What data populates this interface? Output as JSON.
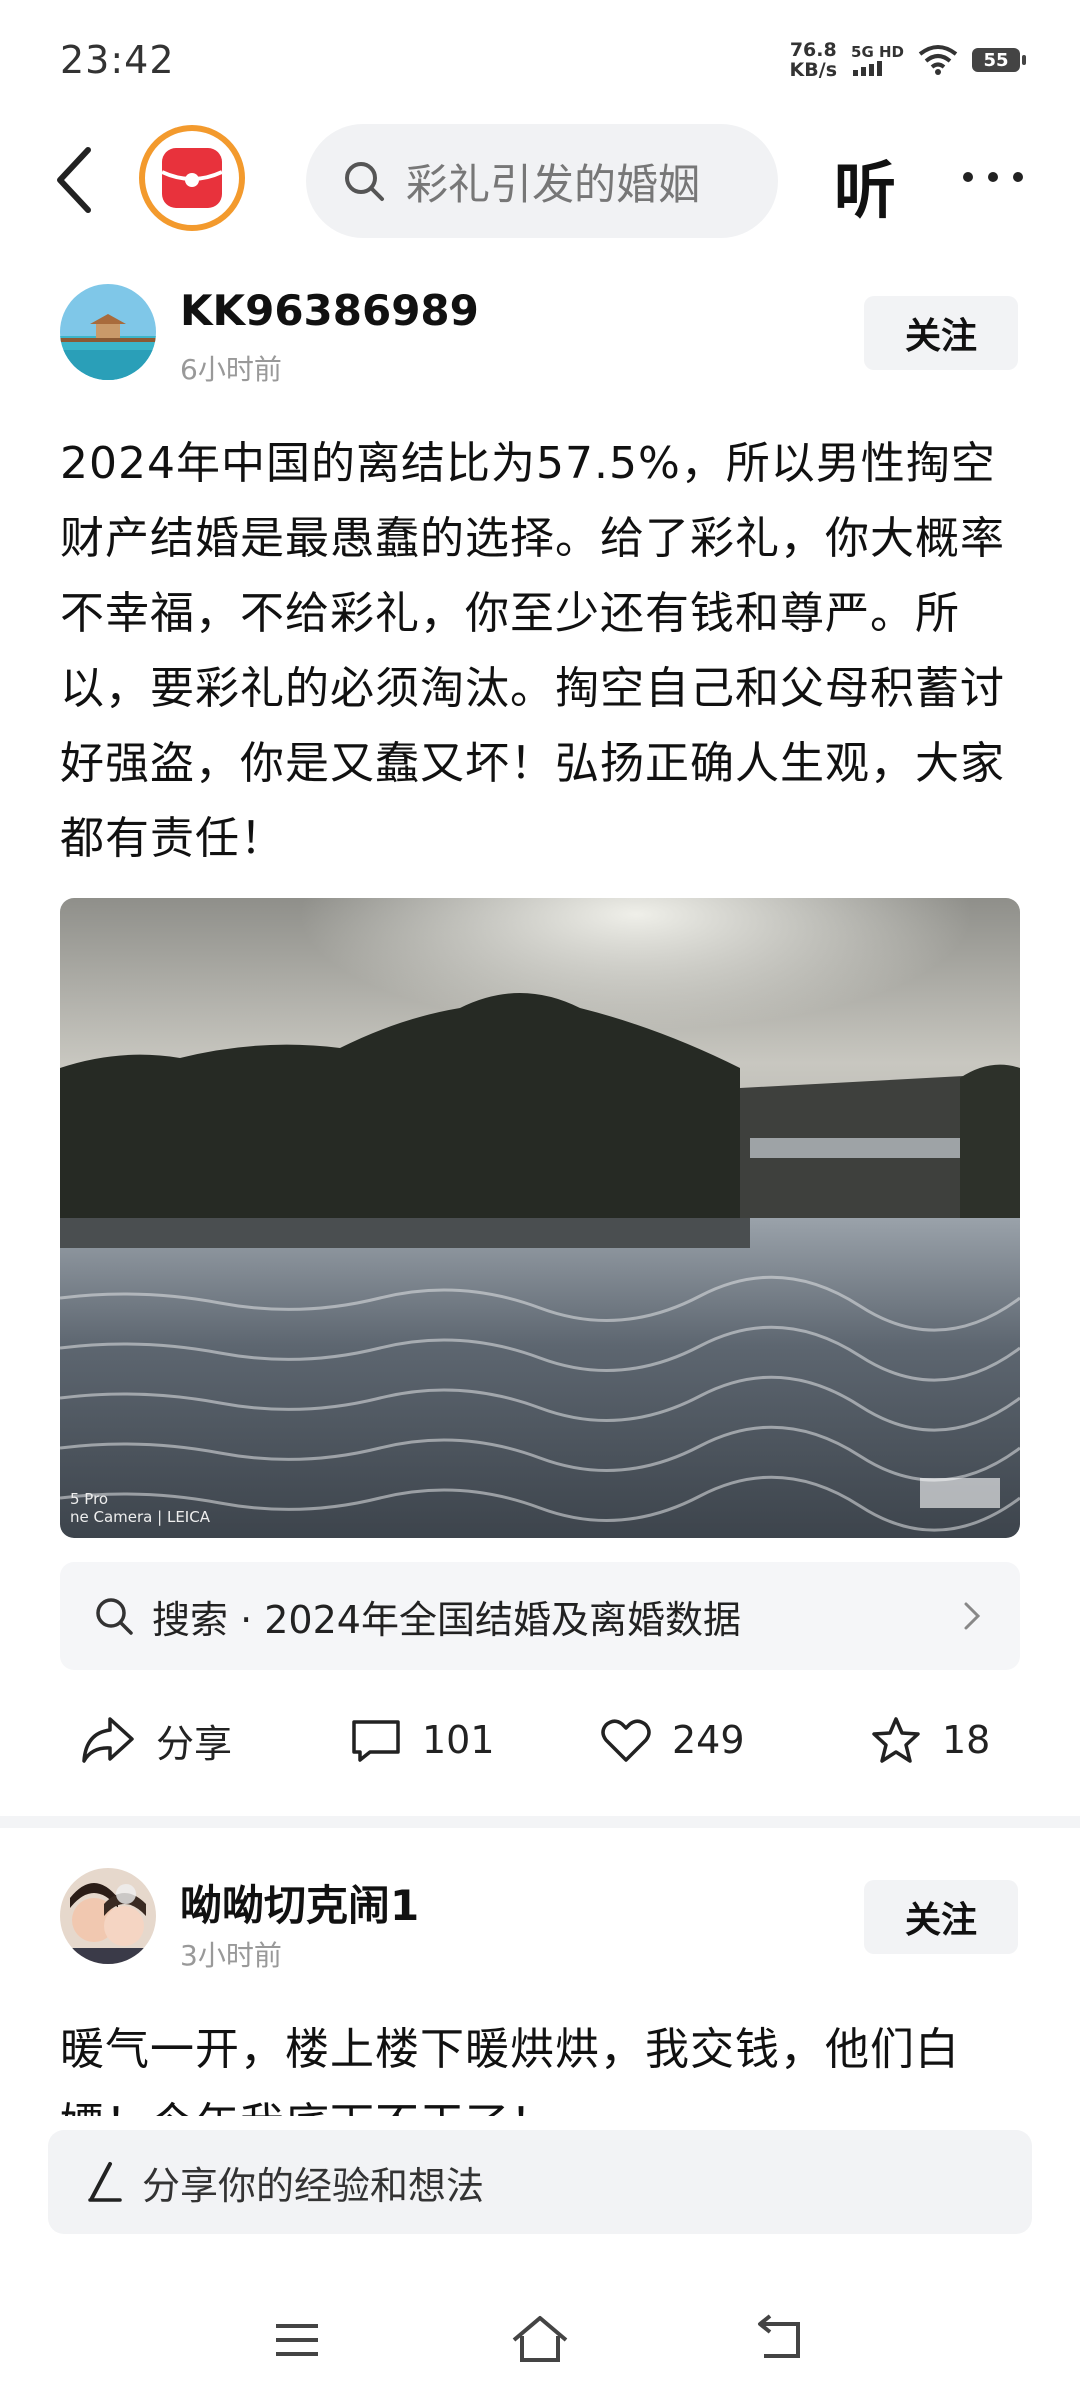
{
  "status_bar": {
    "time": "23:42",
    "speed_value": "76.8",
    "speed_unit": "KB/s",
    "network": "5G HD",
    "battery": "55"
  },
  "top_nav": {
    "search_placeholder": "彩礼引发的婚姻",
    "listen_label": "听",
    "icons": [
      "back-icon",
      "app-logo-icon",
      "search-icon",
      "more-icon"
    ]
  },
  "post1": {
    "username": "KK96386989",
    "time": "6小时前",
    "follow_label": "关注",
    "text": "2024年中国的离结比为57.5%，所以男性掏空财产结婚是最愚蠢的选择。给了彩礼，你大概率不幸福，不给彩礼，你至少还有钱和尊严。所以，要彩礼的必须淘汰。掏空自己和父母积蓄讨好强盗，你是又蠢又坏！弘扬正确人生观，大家都有责任！",
    "photo_watermark_line1": "5 Pro",
    "photo_watermark_line2": "ne Camera | LEICA",
    "search_suggestion": "搜索 · 2024年全国结婚及离婚数据",
    "actions": {
      "share_label": "分享",
      "comments": "101",
      "likes": "249",
      "favorites": "18"
    }
  },
  "post2": {
    "username": "呦呦切克闹1",
    "time": "3小时前",
    "follow_label": "关注",
    "text": "暖气一开，楼上楼下暖烘烘，我交钱，他们白嫖！今年我底下不干了！"
  },
  "comment_bar": {
    "placeholder": "分享你的经验和想法"
  },
  "colors": {
    "logo_red": "#e8323c",
    "logo_ring": "#f39a2d",
    "card_bg": "#f5f6f8"
  }
}
